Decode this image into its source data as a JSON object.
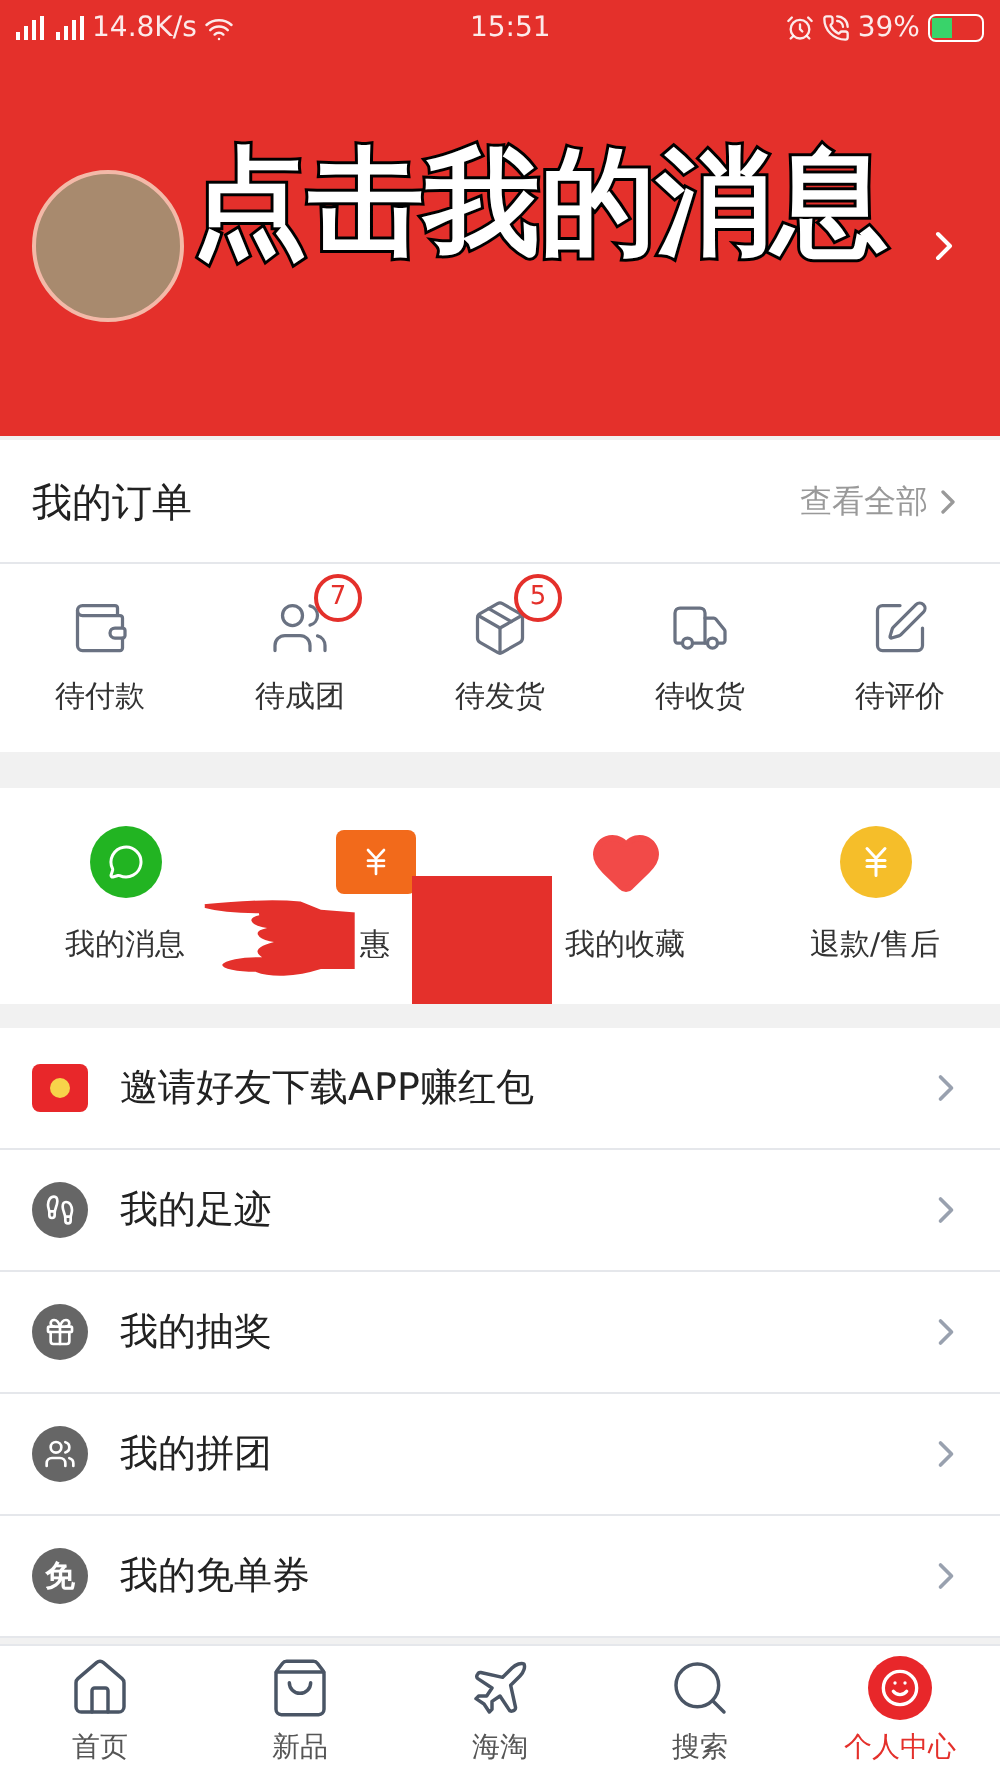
{
  "status_bar": {
    "speed": "14.8K/s",
    "time": "15:51",
    "battery": "39%"
  },
  "header": {
    "overlay_caption": "点击我的消息"
  },
  "orders": {
    "title": "我的订单",
    "view_all": "查看全部",
    "items": [
      {
        "kind": "payment",
        "label": "待付款"
      },
      {
        "kind": "group",
        "label": "待成团",
        "badge": "7"
      },
      {
        "kind": "ship",
        "label": "待发货",
        "badge": "5"
      },
      {
        "kind": "receive",
        "label": "待收货"
      },
      {
        "kind": "review",
        "label": "待评价"
      }
    ]
  },
  "services": [
    {
      "kind": "message",
      "label": "我的消息"
    },
    {
      "kind": "coupon",
      "label": "惠"
    },
    {
      "kind": "favorite",
      "label": "我的收藏"
    },
    {
      "kind": "refund",
      "label": "退款/售后"
    }
  ],
  "menu": [
    {
      "kind": "red_packet",
      "label": "邀请好友下载APP赚红包"
    },
    {
      "kind": "footprint",
      "label": "我的足迹"
    },
    {
      "kind": "lottery",
      "label": "我的抽奖"
    },
    {
      "kind": "group",
      "label": "我的拼团"
    },
    {
      "kind": "glyph",
      "icon_text": "免",
      "label": "我的免单券"
    }
  ],
  "tab_bar": [
    {
      "kind": "home",
      "label": "首页",
      "selected": false
    },
    {
      "kind": "new",
      "label": "新品",
      "selected": false
    },
    {
      "kind": "overseas",
      "label": "海淘",
      "selected": false
    },
    {
      "kind": "search",
      "label": "搜索",
      "selected": false
    },
    {
      "kind": "profile",
      "label": "个人中心",
      "selected": true
    }
  ]
}
